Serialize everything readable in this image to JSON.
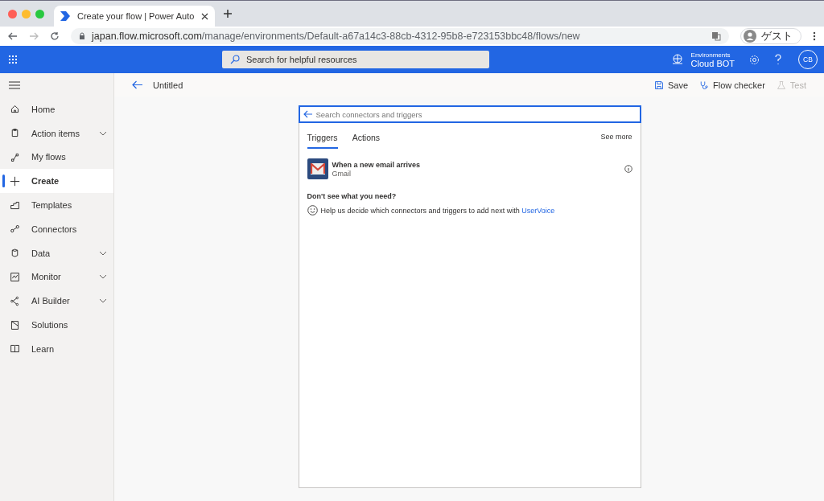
{
  "browser": {
    "tab_title": "Create your flow | Power Auto",
    "url_host": "japan.flow.microsoft.com",
    "url_path": "/manage/environments/Default-a67a14c3-88cb-4312-95b8-e723153bbc48/flows/new",
    "profile": "ゲスト"
  },
  "header": {
    "search_placeholder": "Search for helpful resources",
    "environment_label": "Environments",
    "environment_name": "Cloud BOT",
    "avatar": "CB"
  },
  "sidebar": {
    "items": [
      {
        "label": "Home",
        "expandable": false,
        "selected": false
      },
      {
        "label": "Action items",
        "expandable": true,
        "selected": false
      },
      {
        "label": "My flows",
        "expandable": false,
        "selected": false
      },
      {
        "label": "Create",
        "expandable": false,
        "selected": true
      },
      {
        "label": "Templates",
        "expandable": false,
        "selected": false
      },
      {
        "label": "Connectors",
        "expandable": false,
        "selected": false
      },
      {
        "label": "Data",
        "expandable": true,
        "selected": false
      },
      {
        "label": "Monitor",
        "expandable": true,
        "selected": false
      },
      {
        "label": "AI Builder",
        "expandable": true,
        "selected": false
      },
      {
        "label": "Solutions",
        "expandable": false,
        "selected": false
      },
      {
        "label": "Learn",
        "expandable": false,
        "selected": false
      }
    ]
  },
  "command_bar": {
    "title": "Untitled",
    "actions": [
      {
        "label": "Save",
        "disabled": false
      },
      {
        "label": "Flow checker",
        "disabled": false
      },
      {
        "label": "Test",
        "disabled": true
      }
    ]
  },
  "picker": {
    "search_placeholder": "Search connectors and triggers",
    "see_more": "See more",
    "tabs": [
      {
        "label": "Triggers",
        "selected": true
      },
      {
        "label": "Actions",
        "selected": false
      }
    ],
    "results": [
      {
        "title": "When a new email arrives",
        "connector": "Gmail"
      }
    ],
    "help_heading": "Don't see what you need?",
    "help_text": "Help us decide which connectors and triggers to add next with ",
    "help_link": "UserVoice"
  }
}
